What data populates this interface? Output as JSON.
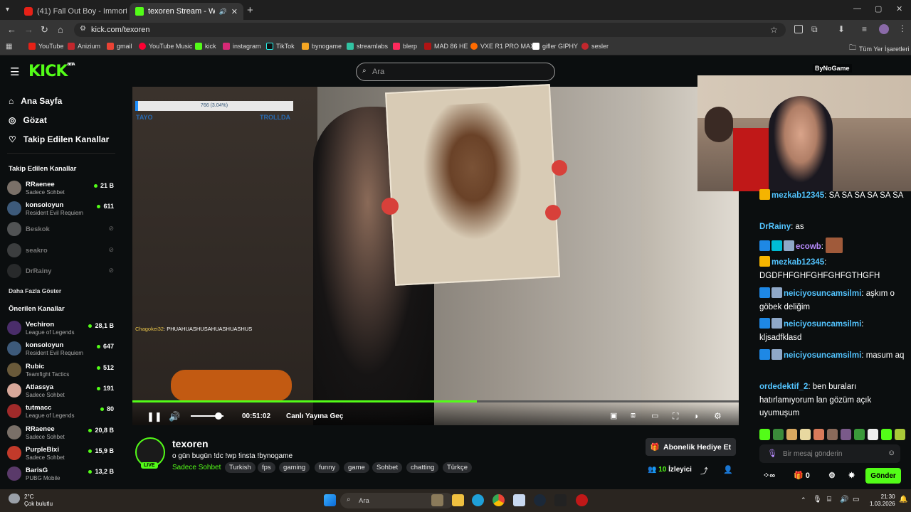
{
  "tabs": [
    {
      "title": "(41) Fall Out Boy - Immortals (fr",
      "active": false
    },
    {
      "title": "texoren Stream - Watch Live",
      "active": true
    }
  ],
  "address": {
    "url": "kick.com/texoren"
  },
  "bookmarks": [
    "YouTube",
    "Anizium",
    "gmail",
    "YouTube Music",
    "kick",
    "instagram",
    "TikTok",
    "bynogame",
    "streamlabs",
    "blerp",
    "MAD 86 HE",
    "VXE R1 PRO MAX",
    "gifler GIPHY",
    "sesler"
  ],
  "bookmarks_right": "Tüm Yer İşaretleri",
  "kick": {
    "logo": "KICK",
    "beta": "BETA",
    "search_placeholder": "Ara"
  },
  "nav": [
    {
      "label": "Ana Sayfa",
      "icon": "home-icon"
    },
    {
      "label": "Gözat",
      "icon": "compass-icon"
    },
    {
      "label": "Takip Edilen Kanallar",
      "icon": "heart-icon"
    }
  ],
  "followed": {
    "heading": "Takip Edilen Kanallar",
    "channels": [
      {
        "name": "RRaenee",
        "category": "Sadece Sohbet",
        "viewers": "21 B",
        "live": true
      },
      {
        "name": "konsoloyun",
        "category": "Resident Evil Requiem",
        "viewers": "611",
        "live": true
      },
      {
        "name": "Beskok",
        "category": "",
        "viewers": "",
        "live": false
      },
      {
        "name": "seakro",
        "category": "",
        "viewers": "",
        "live": false
      },
      {
        "name": "DrRainy",
        "category": "",
        "viewers": "",
        "live": false
      }
    ],
    "more": "Daha Fazla Göster"
  },
  "recommended": {
    "heading": "Önerilen Kanallar",
    "channels": [
      {
        "name": "Vechiron",
        "category": "League of Legends",
        "viewers": "28,1 B"
      },
      {
        "name": "konsoloyun",
        "category": "Resident Evil Requiem",
        "viewers": "647"
      },
      {
        "name": "Rubic",
        "category": "Teamfight Tactics",
        "viewers": "512"
      },
      {
        "name": "Atlassya",
        "category": "Sadece Sohbet",
        "viewers": "191"
      },
      {
        "name": "tutmacc",
        "category": "League of Legends",
        "viewers": "80"
      },
      {
        "name": "RRaenee",
        "category": "Sadece Sohbet",
        "viewers": "20,8 B"
      },
      {
        "name": "PurpleBixi",
        "category": "Sadece Sohbet",
        "viewers": "15,9 B"
      },
      {
        "name": "BarisG",
        "category": "PUBG Mobile",
        "viewers": "13,2 B"
      }
    ]
  },
  "player": {
    "poll_text": "766 (3.04%)",
    "poll_left": "TAYO",
    "poll_right": "TROLLDA",
    "overlay_chat_user": "Chagokei32",
    "overlay_chat_text": ": PHUAHUASHUSAHUASHUASHUS",
    "timecode": "00:51:02",
    "go_live": "Canlı Yayına Geç",
    "progress": 0.568,
    "volume": 0.85
  },
  "stream": {
    "channel": "texoren",
    "live_badge": "LIVE",
    "title": "o gün bugün !dc !wp !insta !bynogame",
    "category": "Sadece Sohbet",
    "tags": [
      "Turkish",
      "fps",
      "gaming",
      "funny",
      "game",
      "Sohbet",
      "chatting",
      "Türkçe"
    ],
    "gift_button": "Abonelik Hediye Et",
    "viewers_count": "10",
    "viewers_label": "İzleyici"
  },
  "webcam": {
    "label": "ByNoGame"
  },
  "chat": {
    "messages": [
      {
        "user": "mezkab12345",
        "text": "SA SA SA SA SA SA",
        "color": "#53c4ff"
      },
      {
        "user": "DrRainy",
        "text": "as",
        "color": "#53c4ff"
      },
      {
        "user": "ecowb",
        "text": "",
        "color": "#b98cff"
      },
      {
        "user": "mezkab12345",
        "text": "DGDFHFGHFGHFGHFGTHGFH",
        "color": "#53c4ff"
      },
      {
        "user": "neiciyosuncamsilmi",
        "text": "aşkım o göbek deliğim",
        "color": "#53c4ff"
      },
      {
        "user": "neiciyosuncamsilmi",
        "text": "kljsadfklasd",
        "color": "#53c4ff"
      },
      {
        "user": "neiciyosuncamsilmi",
        "text": "masum aq",
        "color": "#53c4ff"
      },
      {
        "user": "ordedektif_2",
        "text": "ben buraları hatırlamıyorum lan gözüm açık uyumuşum",
        "color": "#53c4ff"
      }
    ],
    "input_placeholder": "Bir mesaj gönderin",
    "points": "0",
    "send": "Gönder"
  },
  "taskbar": {
    "temp": "2°C",
    "weather": "Çok bulutlu",
    "search": "Ara",
    "time": "21:30",
    "date": "1.03.2026"
  }
}
